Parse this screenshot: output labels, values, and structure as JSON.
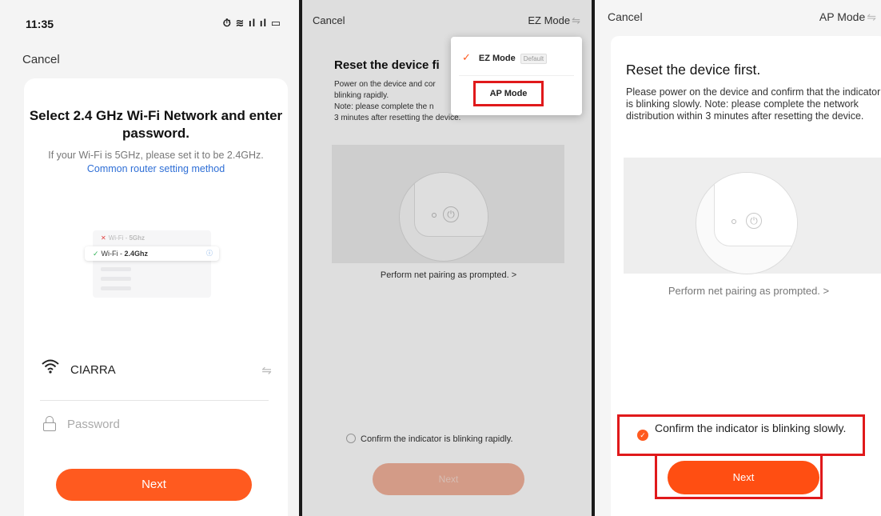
{
  "panel1": {
    "status": {
      "time": "11:35",
      "icons": "⏱ ≋ ıl ıl ▭"
    },
    "cancel": "Cancel",
    "title": "Select 2.4 GHz Wi-Fi Network and enter password.",
    "subtitle": "If your Wi-Fi is 5GHz, please set it to be 2.4GHz.",
    "subtitle_link": "Common router setting method",
    "illustration": {
      "row1_prefix": "Wi-Fi - ",
      "row1_name": "5Ghz",
      "row2_prefix": "Wi-Fi - ",
      "row2_name": "2.4Ghz"
    },
    "wifi_ssid": "CIARRA",
    "password_placeholder": "Password",
    "next": "Next"
  },
  "panel2": {
    "cancel": "Cancel",
    "mode": "EZ Mode",
    "title": "Reset the device fi",
    "body_line1": "Power on the device and cor",
    "body_line2": "blinking rapidly.",
    "body_line3": "Note: please complete the n",
    "body_line4": "3 minutes after resetting the device.",
    "link": "Perform net pairing as prompted. >",
    "confirm": "Confirm the indicator is blinking rapidly.",
    "next": "Next",
    "dropdown": {
      "option1": "EZ Mode",
      "option1_badge": "Default",
      "option2": "AP Mode"
    }
  },
  "panel3": {
    "cancel": "Cancel",
    "mode": "AP Mode",
    "title": "Reset the device first.",
    "body": "Please power on the device and confirm that the indicator is blinking slowly. Note: please complete the network distribution within 3 minutes after resetting the device.",
    "link": "Perform net pairing as prompted. >",
    "confirm": "Confirm the indicator is blinking slowly.",
    "next": "Next"
  }
}
